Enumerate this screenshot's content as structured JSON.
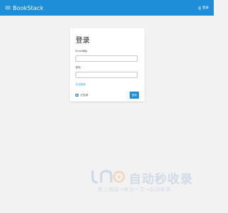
{
  "header": {
    "brand_name": "BookStack",
    "login_label": "登录",
    "brand_icon": "book-logo-icon",
    "login_icon": "login-icon",
    "color": "#1f8ed8"
  },
  "login_card": {
    "title": "登录",
    "email_label": "Email地址",
    "email_value": "",
    "password_label": "密码",
    "password_value": "",
    "forgot_link": "忘记密码",
    "remember_label": "记住我",
    "remember_checked": false,
    "submit_label": "登录"
  },
  "watermark": {
    "title": "自动秒收录",
    "subtitle": "做上链接→来访一次→自动收录"
  }
}
